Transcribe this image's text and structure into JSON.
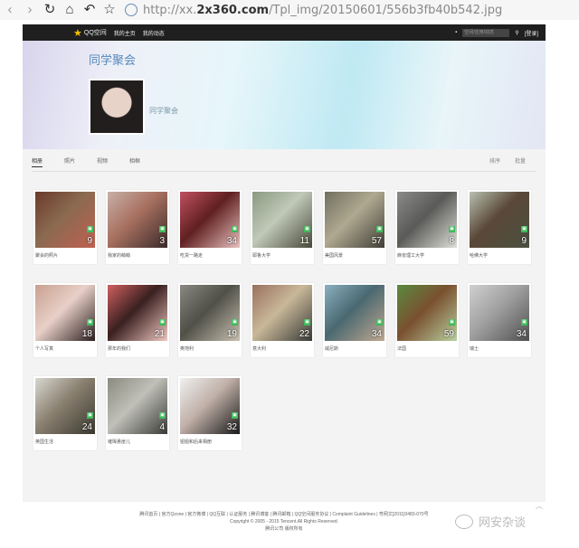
{
  "browser": {
    "url_prefix": "http://xx.",
    "url_host": "2x360.com",
    "url_path": "/Tpl_img/20150601/556b3fb40b542.jpg"
  },
  "qzone_bar": {
    "brand": "QQ空间",
    "nav": [
      "我的主页",
      "我的动态"
    ],
    "search_placeholder": "空间/应用/动态",
    "login": "[登录]"
  },
  "album": {
    "title": "同学聚会",
    "subtitle": "同学聚会"
  },
  "tabs": [
    "相册",
    "照片",
    "视频",
    "相框"
  ],
  "tools": [
    "排序",
    "批量"
  ],
  "cards": [
    {
      "caption": "聚会的照片",
      "count": "9",
      "colors": [
        "#6a3a2a",
        "#c06050",
        "#8a6a50"
      ]
    },
    {
      "caption": "我家的萌萌",
      "count": "3",
      "colors": [
        "#c8b0a8",
        "#3a2a2a",
        "#a87060"
      ]
    },
    {
      "caption": "吃货一路走",
      "count": "34",
      "colors": [
        "#c05060",
        "#e8c0c0",
        "#602020"
      ]
    },
    {
      "caption": "耶鲁大学",
      "count": "11",
      "colors": [
        "#8a9a80",
        "#4a4a3a",
        "#c0c8b8"
      ]
    },
    {
      "caption": "美国风景",
      "count": "57",
      "colors": [
        "#707060",
        "#404038",
        "#b0a890"
      ]
    },
    {
      "caption": "麻省理工大学",
      "count": "8",
      "colors": [
        "#8a8a8a",
        "#e0e0d8",
        "#5a5a58"
      ]
    },
    {
      "caption": "哈佛大学",
      "count": "9",
      "colors": [
        "#b8c0b0",
        "#4a5040",
        "#5a4838"
      ]
    },
    {
      "caption": "个人写真",
      "count": "18",
      "colors": [
        "#c8a090",
        "#2a1e1e",
        "#e8d0c8"
      ]
    },
    {
      "caption": "那年的我们",
      "count": "21",
      "colors": [
        "#d06060",
        "#f0c8c0",
        "#3a2020"
      ]
    },
    {
      "caption": "奥地利",
      "count": "19",
      "colors": [
        "#8a8880",
        "#c8c0b0",
        "#505048"
      ]
    },
    {
      "caption": "意大利",
      "count": "22",
      "colors": [
        "#9a7060",
        "#3a3a38",
        "#c8b898"
      ]
    },
    {
      "caption": "威尼斯",
      "count": "34",
      "colors": [
        "#8ab0c0",
        "#c0a890",
        "#4a6870"
      ]
    },
    {
      "caption": "法国",
      "count": "59",
      "colors": [
        "#5a8a40",
        "#b8d0a0",
        "#7a5030"
      ]
    },
    {
      "caption": "瑞士",
      "count": "34",
      "colors": [
        "#d0d0d0",
        "#505050",
        "#a0a0a0"
      ]
    },
    {
      "caption": "英国生活",
      "count": "24",
      "colors": [
        "#d8d8d0",
        "#3a3830",
        "#8a8070"
      ]
    },
    {
      "caption": "璀璨悬崖儿",
      "count": "4",
      "colors": [
        "#8a8a80",
        "#3a3a38",
        "#c0c0b8"
      ]
    },
    {
      "caption": "姐姐和后来相册",
      "count": "32",
      "colors": [
        "#f0f0f0",
        "#1a1a1a",
        "#c0b0a8"
      ]
    }
  ],
  "footer": {
    "line1": "腾讯首页 | 官方Qzone | 官方微博 | QQ互联 | 认证服务 | 腾讯博客 | 腾讯邮箱 | QQ空间服务协议 | Complaint Guidelines | 粤网文[2011]0483-070号",
    "line2": "Copyright © 2005 - 2015 Tencent.All Rights Reserved.",
    "line3": "腾讯公司 版权所有"
  },
  "watermark": "网安杂谈"
}
